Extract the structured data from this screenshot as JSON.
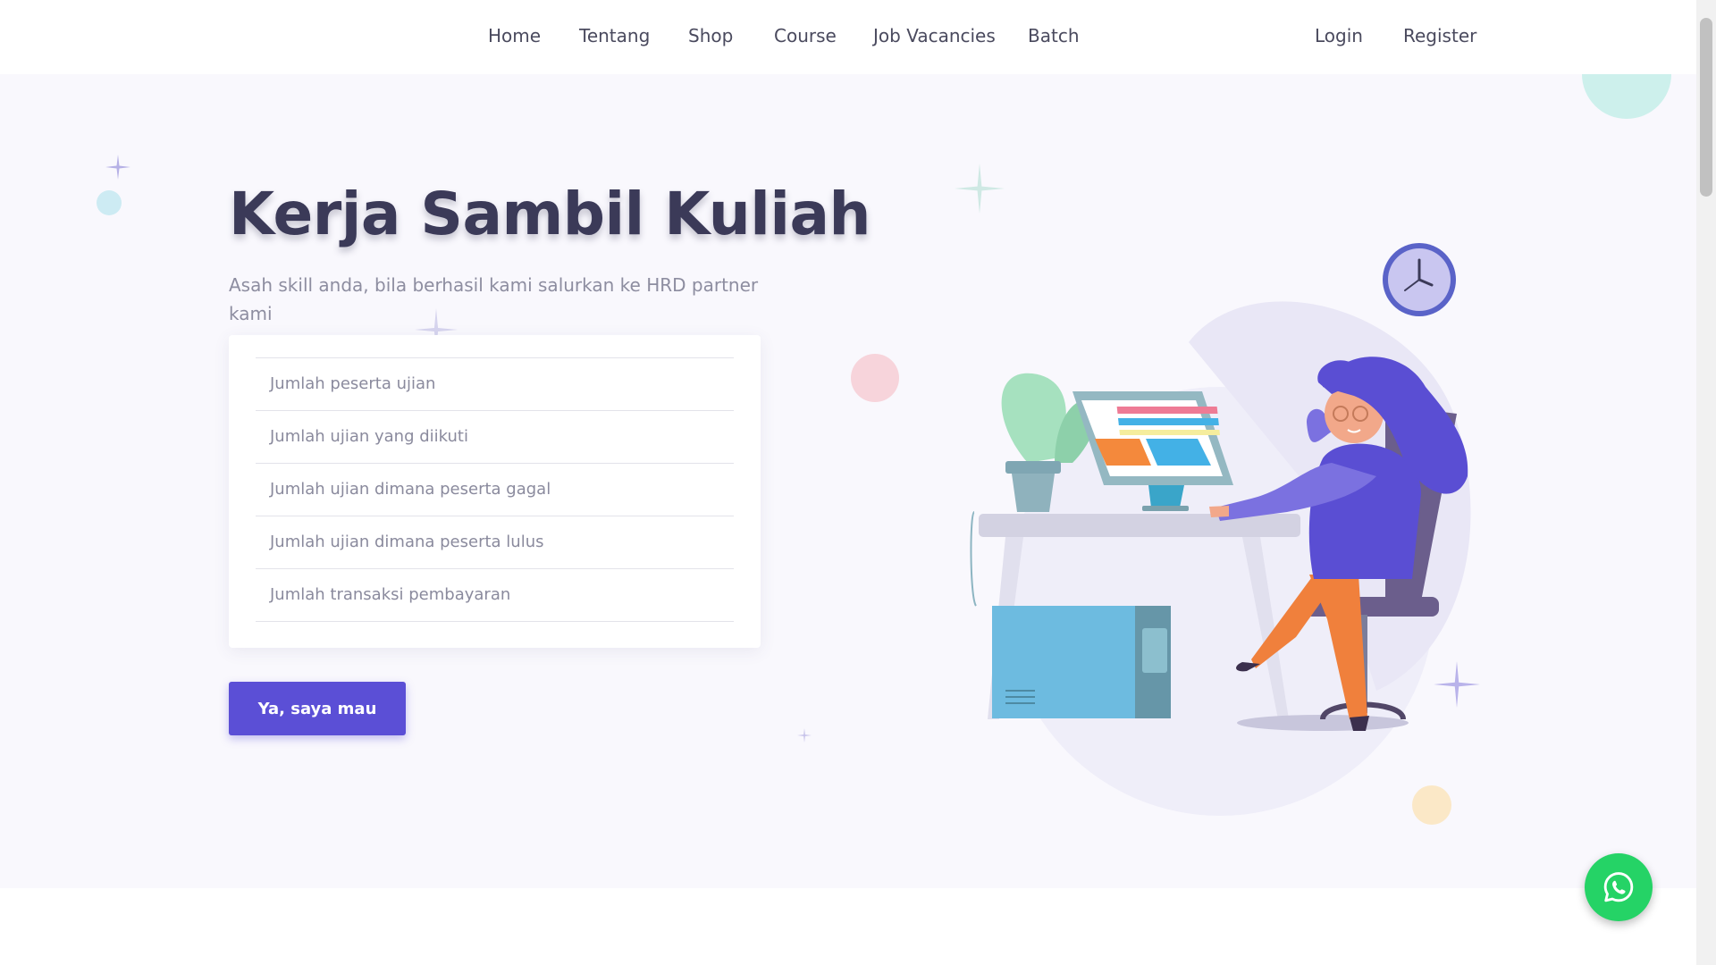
{
  "nav": {
    "links": [
      {
        "label": "Home"
      },
      {
        "label": "Tentang"
      },
      {
        "label": "Shop"
      },
      {
        "label": "Course"
      },
      {
        "label": "Job Vacancies"
      },
      {
        "label": "Batch"
      }
    ],
    "auth": {
      "login": "Login",
      "register": "Register"
    }
  },
  "hero": {
    "title": "Kerja Sambil Kuliah",
    "subtitle": "Asah skill anda, bila berhasil kami salurkan ke HRD partner kami",
    "stats": [
      {
        "label": "Jumlah peserta ujian"
      },
      {
        "label": "Jumlah ujian yang diikuti"
      },
      {
        "label": "Jumlah ujian dimana peserta gagal"
      },
      {
        "label": "Jumlah ujian dimana peserta lulus"
      },
      {
        "label": "Jumlah transaksi pembayaran"
      }
    ],
    "cta_label": "Ya, saya mau"
  },
  "icons": {
    "whatsapp": "whatsapp-icon",
    "illustration": "woman-at-desk-illustration"
  },
  "colors": {
    "accent": "#5b4fd6",
    "whatsapp": "#25d366",
    "hero_background": "#f9f8fd",
    "title": "#3b3a58"
  }
}
